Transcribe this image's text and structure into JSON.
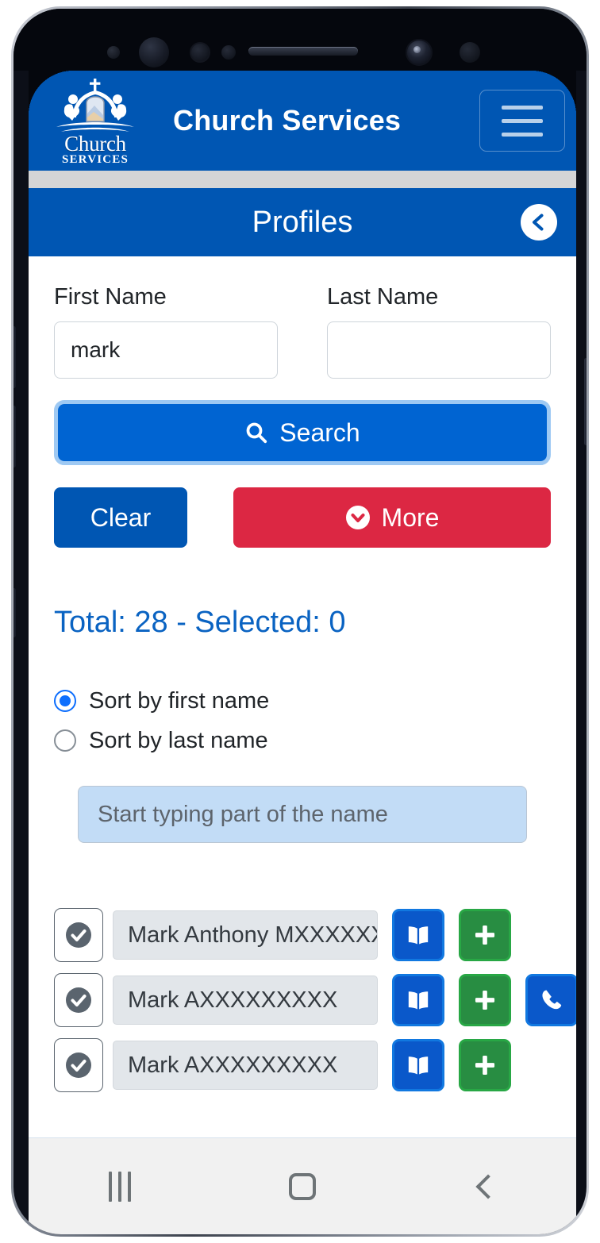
{
  "app": {
    "header_title": "Church Services",
    "logo_word": "Church",
    "logo_sub": "SERVICES",
    "menu_icon": "hamburger-icon"
  },
  "page": {
    "title": "Profiles",
    "back_icon": "arrow-left-circle-icon"
  },
  "form": {
    "first_name_label": "First Name",
    "first_name_value": "mark",
    "first_name_placeholder": "",
    "last_name_label": "Last Name",
    "last_name_value": "",
    "last_name_placeholder": "",
    "search_label": "Search",
    "search_icon": "search-icon",
    "clear_label": "Clear",
    "more_label": "More",
    "more_icon": "chevron-down-circle-icon"
  },
  "summary": {
    "total_line": "Total: 28 - Selected: 0",
    "total_count": 28,
    "selected_count": 0
  },
  "sort": {
    "options": [
      {
        "label": "Sort by first name",
        "selected": true
      },
      {
        "label": "Sort by last name",
        "selected": false
      }
    ]
  },
  "filter": {
    "placeholder": "Start typing part of the name",
    "value": ""
  },
  "results": {
    "rows": [
      {
        "name": "Mark Anthony MXXXXXXX",
        "check_icon": "check-circle-icon",
        "actions": [
          "book-icon",
          "plus-icon"
        ]
      },
      {
        "name": "Mark AXXXXXXXXX",
        "check_icon": "check-circle-icon",
        "actions": [
          "book-icon",
          "plus-icon",
          "phone-icon"
        ]
      },
      {
        "name": "Mark AXXXXXXXXX",
        "check_icon": "check-circle-icon",
        "actions": [
          "book-icon",
          "plus-icon"
        ]
      }
    ]
  },
  "system_nav": {
    "recents_icon": "recents-icon",
    "home_icon": "home-icon",
    "back_icon": "back-icon"
  },
  "colors": {
    "brand_blue": "#0056b3",
    "search_blue": "#0064d2",
    "danger_red": "#dc2743",
    "success_green": "#288d42",
    "accent_link": "#0a63c2",
    "filter_bg": "#c2dcf6"
  }
}
